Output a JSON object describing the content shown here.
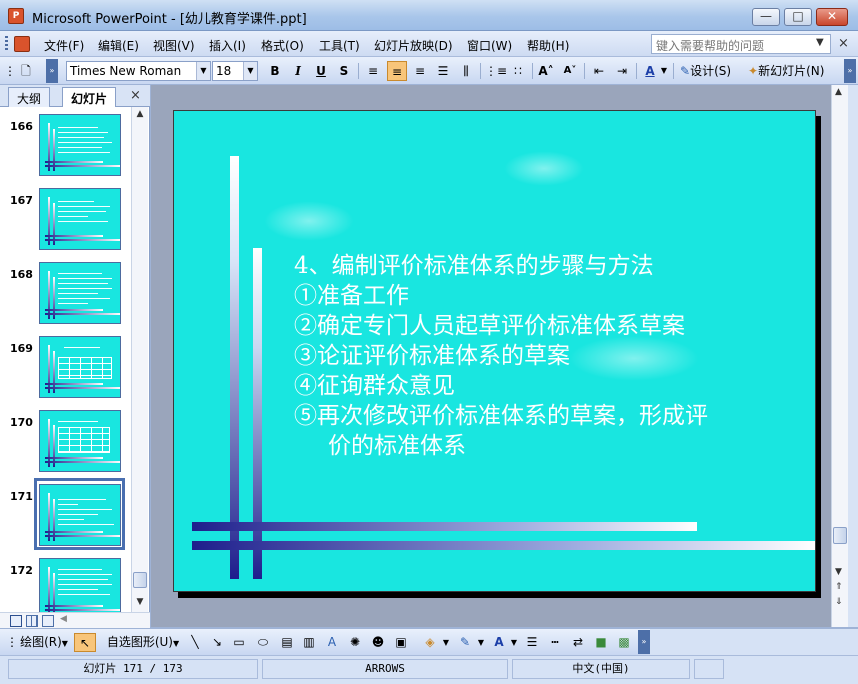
{
  "window": {
    "app_icon": "powerpoint-icon",
    "title": "Microsoft PowerPoint - [幼儿教育学课件.ppt]",
    "minimize": "—",
    "maximize": "□",
    "close": "✕"
  },
  "menu": {
    "items": [
      "文件(F)",
      "编辑(E)",
      "视图(V)",
      "插入(I)",
      "格式(O)",
      "工具(T)",
      "幻灯片放映(D)",
      "窗口(W)",
      "帮助(H)"
    ],
    "help_placeholder": "键入需要帮助的问题",
    "close": "×"
  },
  "toolbar": {
    "font_name": "Times New Roman",
    "font_size": "18",
    "bold": "B",
    "italic": "I",
    "underline": "U",
    "shadow": "S",
    "font_color": "A",
    "design_label": "设计(S)",
    "new_slide_label": "新幻灯片(N)"
  },
  "left_pane": {
    "tabs": [
      "大纲",
      "幻灯片"
    ],
    "close": "×",
    "thumbnails": [
      {
        "number": "166",
        "selected": false
      },
      {
        "number": "167",
        "selected": false
      },
      {
        "number": "168",
        "selected": false
      },
      {
        "number": "169",
        "selected": false,
        "has_table": true
      },
      {
        "number": "170",
        "selected": false,
        "has_table": true
      },
      {
        "number": "171",
        "selected": true
      },
      {
        "number": "172",
        "selected": false
      }
    ]
  },
  "slide": {
    "background_color": "#19e6e0",
    "lines": [
      "4、编制评价标准体系的步骤与方法",
      "①准备工作",
      "②确定专门人员起草评价标准体系草案",
      "③论证评价标准体系的草案",
      "④征询群众意见",
      "⑤再次修改评价标准体系的草案，形成评",
      "价的标准体系"
    ]
  },
  "drawing_toolbar": {
    "draw_label": "绘图(R)",
    "autoshape_label": "自选图形(U)"
  },
  "status": {
    "slide_position": "幻灯片 171 / 173",
    "design": "ARROWS",
    "language": "中文(中国)"
  }
}
